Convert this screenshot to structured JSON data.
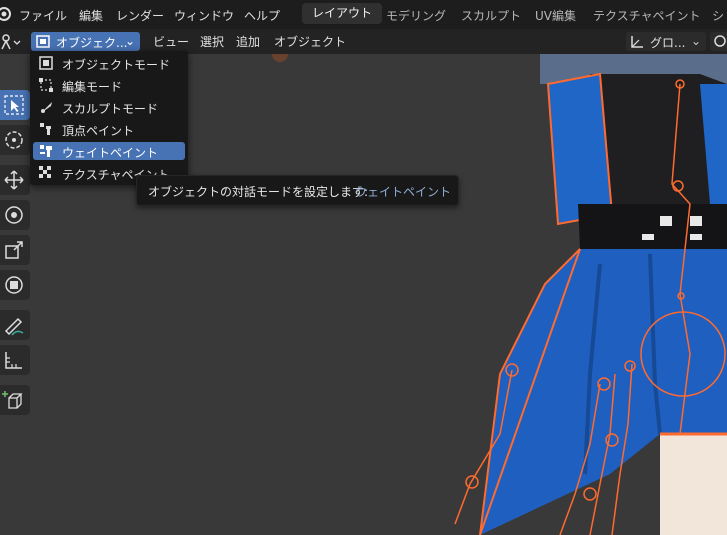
{
  "menubar": {
    "items": [
      "ファイル",
      "編集",
      "レンダー",
      "ウィンドウ",
      "ヘルプ"
    ],
    "workspaces": [
      "レイアウト",
      "モデリング",
      "スカルプト",
      "UV編集",
      "テクスチャペイント",
      "シ"
    ],
    "active_workspace": "レイアウト"
  },
  "header": {
    "mode_label": "オブジェク...",
    "menus": [
      "ビュー",
      "選択",
      "追加",
      "オブジェクト"
    ],
    "orientation_label": "グロ..."
  },
  "mode_menu": {
    "items": [
      "オブジェクトモード",
      "編集モード",
      "スカルプトモード",
      "頂点ペイント",
      "ウェイトペイント",
      "テクスチャペイント"
    ],
    "selected_index": 4
  },
  "tooltip": {
    "text": "オブジェクトの対話モードを設定します:",
    "value": "ウェイトペイント"
  },
  "colors": {
    "accent": "#4772b3",
    "armature_orange": "#ff6a2e",
    "cloth_blue": "#1e64c8"
  }
}
